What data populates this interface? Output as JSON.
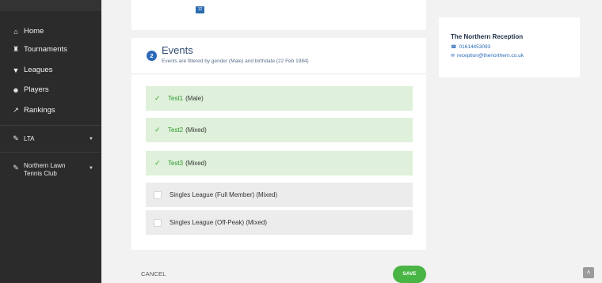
{
  "sidebar": {
    "items": [
      {
        "label": "Home",
        "icon": "home-icon"
      },
      {
        "label": "Tournaments",
        "icon": "trophy-icon"
      },
      {
        "label": "Leagues",
        "icon": "cup-icon"
      },
      {
        "label": "Players",
        "icon": "users-icon"
      },
      {
        "label": "Rankings",
        "icon": "chart-icon"
      }
    ],
    "association": {
      "label": "LTA",
      "icon": "wrench-icon"
    },
    "club": {
      "label": "Northern Lawn Tennis Club",
      "icon": "wrench-icon"
    }
  },
  "top_card": {
    "badge": "12"
  },
  "events": {
    "step": "2",
    "title": "Events",
    "subtitle": "Events are filtered by gender (Male) and birthdate (22 Feb 1984)",
    "options": [
      {
        "name": "Test1",
        "detail": "(Male)",
        "selected": true
      },
      {
        "name": "Test2",
        "detail": "(Mixed)",
        "selected": true
      },
      {
        "name": "Test3",
        "detail": "(Mixed)",
        "selected": true
      },
      {
        "name": "Singles League (Full Member) (Mixed)",
        "detail": "",
        "selected": false
      },
      {
        "name": "Singles League (Off-Peak) (Mixed)",
        "detail": "",
        "selected": false
      }
    ]
  },
  "actions": {
    "cancel": "CANCEL",
    "save": "SAVE"
  },
  "venue": {
    "name": "The Northern Reception",
    "phone": "01614453093",
    "email": "reception@thenorthern.co.uk"
  },
  "colors": {
    "accent": "#2d68b8",
    "success": "#49b544",
    "selected_bg": "#dff1da"
  }
}
